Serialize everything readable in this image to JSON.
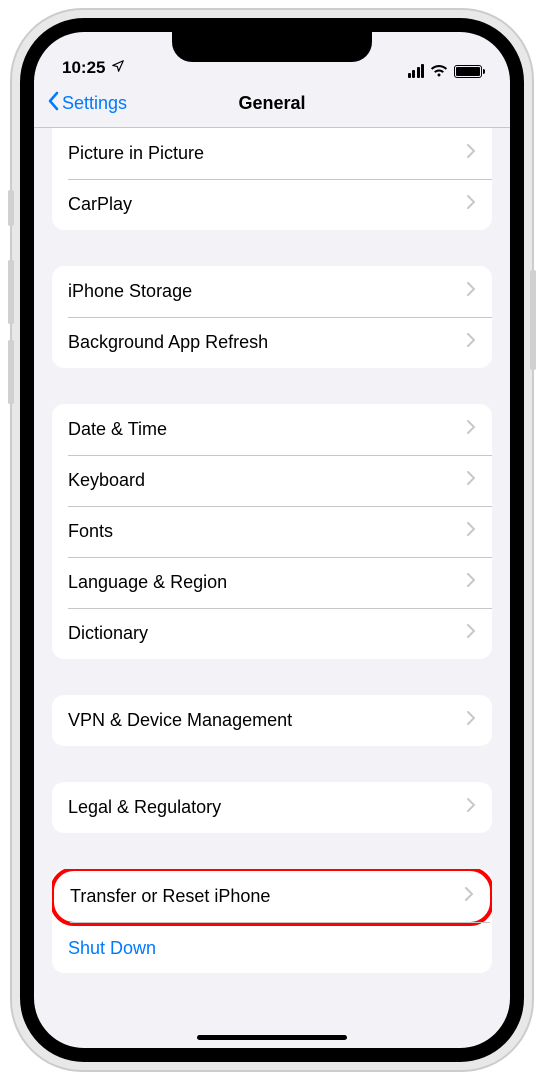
{
  "status": {
    "time": "10:25",
    "location": "➤"
  },
  "nav": {
    "back": "Settings",
    "title": "General"
  },
  "groups": [
    {
      "firstPartial": true,
      "rows": [
        {
          "label": "Picture in Picture",
          "chevron": true
        },
        {
          "label": "CarPlay",
          "chevron": true
        }
      ]
    },
    {
      "rows": [
        {
          "label": "iPhone Storage",
          "chevron": true
        },
        {
          "label": "Background App Refresh",
          "chevron": true
        }
      ]
    },
    {
      "rows": [
        {
          "label": "Date & Time",
          "chevron": true
        },
        {
          "label": "Keyboard",
          "chevron": true
        },
        {
          "label": "Fonts",
          "chevron": true
        },
        {
          "label": "Language & Region",
          "chevron": true
        },
        {
          "label": "Dictionary",
          "chevron": true
        }
      ]
    },
    {
      "rows": [
        {
          "label": "VPN & Device Management",
          "chevron": true
        }
      ]
    },
    {
      "rows": [
        {
          "label": "Legal & Regulatory",
          "chevron": true
        }
      ]
    },
    {
      "rows": [
        {
          "label": "Transfer or Reset iPhone",
          "chevron": true,
          "highlighted": true
        },
        {
          "label": "Shut Down",
          "chevron": false,
          "link": true
        }
      ]
    }
  ]
}
